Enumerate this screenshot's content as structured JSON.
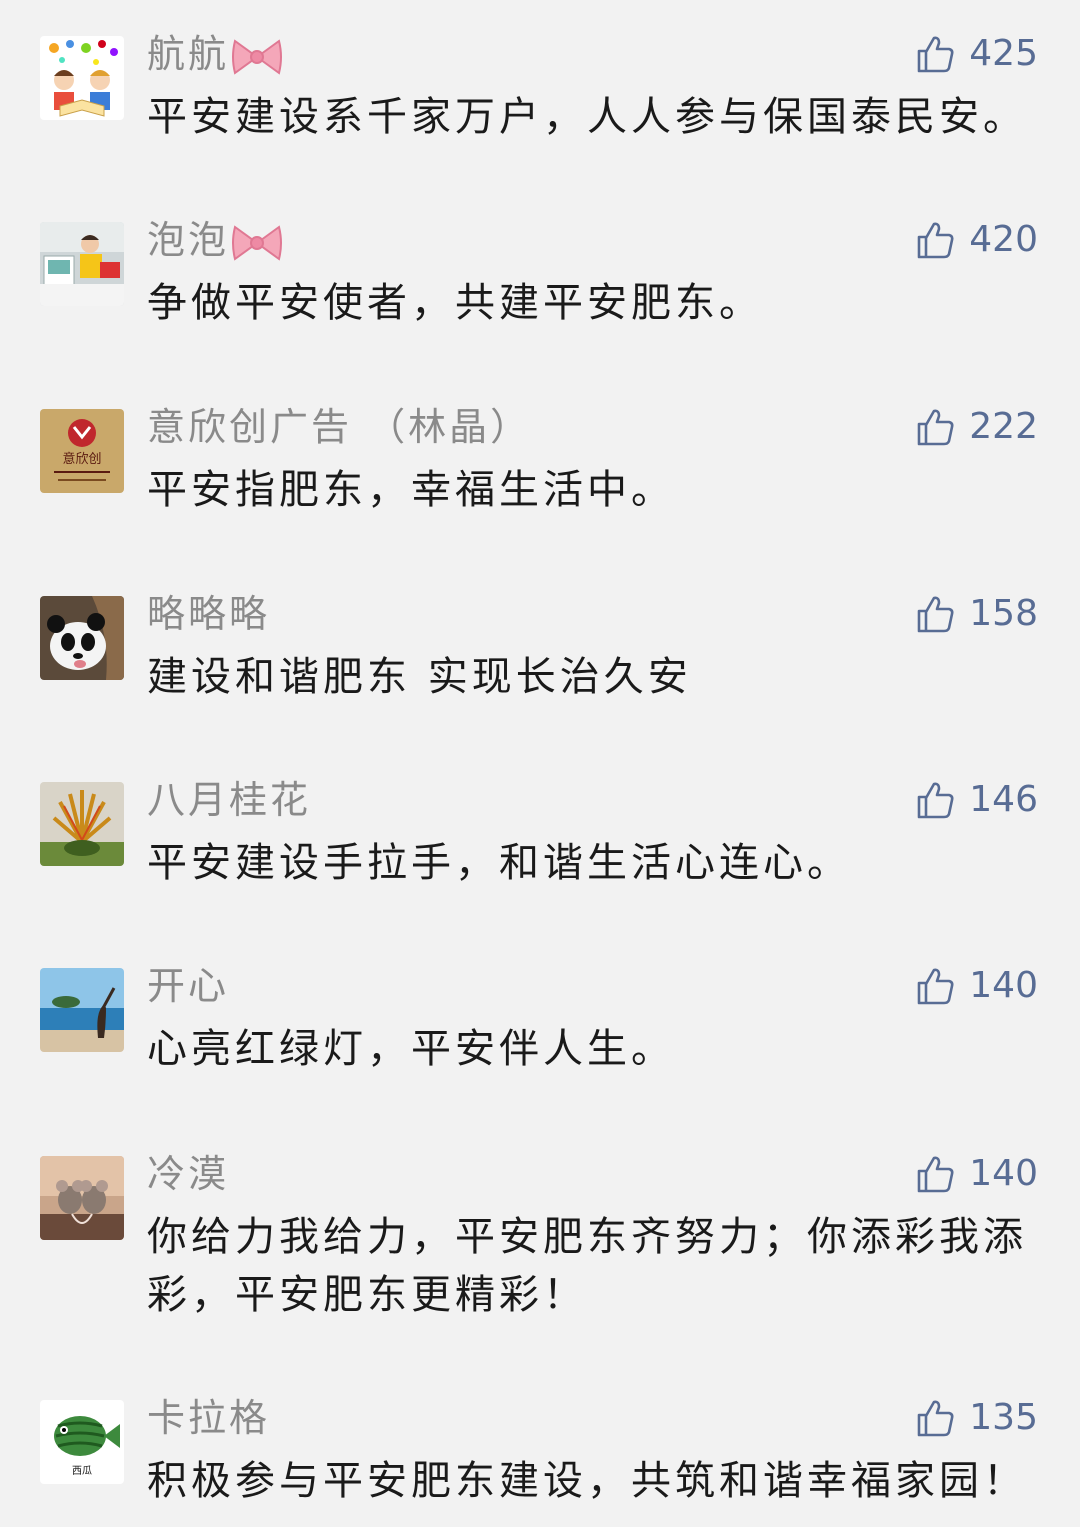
{
  "comments": [
    {
      "nickname": "航航",
      "has_bow": true,
      "avatar": "cartoon-kids-avatar",
      "likes": "425",
      "text": "平安建设系千家万户，人人参与保国泰民安。"
    },
    {
      "nickname": "泡泡",
      "has_bow": true,
      "avatar": "child-photo-avatar",
      "likes": "420",
      "text": "争做平安使者，共建平安肥东。"
    },
    {
      "nickname": "意欣创广告 （林晶）",
      "has_bow": false,
      "avatar": "company-logo-avatar",
      "likes": "222",
      "text": "平安指肥东，幸福生活中。"
    },
    {
      "nickname": "略略略",
      "has_bow": false,
      "avatar": "panda-avatar",
      "likes": "158",
      "text": "建设和谐肥东 实现长治久安"
    },
    {
      "nickname": "八月桂花",
      "has_bow": false,
      "avatar": "plant-avatar",
      "likes": "146",
      "text": "平安建设手拉手，和谐生活心连心。"
    },
    {
      "nickname": "开心",
      "has_bow": false,
      "avatar": "seaside-girl-avatar",
      "likes": "140",
      "text": "心亮红绿灯，平安伴人生。"
    },
    {
      "nickname": "冷漠",
      "has_bow": false,
      "avatar": "mice-avatar",
      "likes": "140",
      "text": "你给力我给力，平安肥东齐努力；你添彩我添彩，平安肥东更精彩！"
    },
    {
      "nickname": "卡拉格",
      "has_bow": false,
      "avatar": "watermelon-fish-avatar",
      "likes": "135",
      "text": "积极参与平安肥东建设，共筑和谐幸福家园！"
    }
  ],
  "avatar_logo_text": "意欣创",
  "avatar_fish_text": "西瓜",
  "colors": {
    "like": "#586c94",
    "nickname": "#8a8a8a",
    "text": "#1a1a1a",
    "background": "#f2f2f2"
  }
}
